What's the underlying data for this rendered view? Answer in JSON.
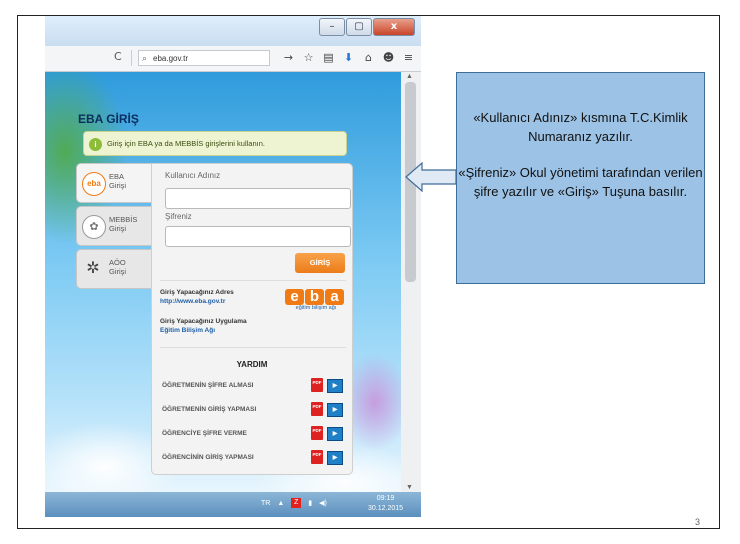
{
  "browser": {
    "window_buttons": {
      "minimize": "–",
      "maximize": "▢",
      "close": "x"
    },
    "reload_icon": "C",
    "url": "eba.gov.tr",
    "toolbar_icons": [
      "→",
      "☆",
      "▤",
      "⬇",
      "⌂",
      "☻",
      "≡"
    ]
  },
  "page": {
    "title": "EBA GİRİŞ",
    "info_text": "Giriş için EBA ya da MEBBİS girişlerini kullanın.",
    "tabs": [
      {
        "label_line1": "EBA",
        "label_line2": "Girişi",
        "icon": "eba-logo-icon",
        "color": "#f07a14"
      },
      {
        "label_line1": "MEBBİS",
        "label_line2": "Girişi",
        "icon": "meb-emblem-icon",
        "color": "#8a8a8a"
      },
      {
        "label_line1": "AÖO",
        "label_line2": "Girişi",
        "icon": "aoo-icon",
        "color": "#555555"
      }
    ],
    "form": {
      "username_label": "Kullanıcı Adınız",
      "username_value": "",
      "password_label": "Şifreniz",
      "password_value": "",
      "submit_label": "GİRİŞ"
    },
    "address_label": "Giriş Yapacağınız Adres",
    "address_value": "http://www.eba.gov.tr",
    "app_label": "Giriş Yapacağınız Uygulama",
    "app_value": "Eğitim Bilişim Ağı",
    "eba_logo_letters": [
      "e",
      "b",
      "a"
    ],
    "eba_logo_sub": "eğitim bilişim ağı",
    "help_title": "YARDIM",
    "help_items": [
      "ÖĞRETMENİN ŞİFRE ALMASI",
      "ÖĞRETMENİN GİRİŞ YAPMASI",
      "ÖĞRENCİYE ŞİFRE VERME",
      "ÖĞRENCİNİN GİRİŞ YAPMASI"
    ],
    "help_pdf_label": "PDF",
    "help_video_label": "▶"
  },
  "taskbar": {
    "lang": "TR",
    "time": "09:19",
    "date": "30.12.2015"
  },
  "callout": {
    "paragraph1": "«Kullanıcı Adınız» kısmına T.C.Kimlik Numaranız yazılır.",
    "paragraph2": "«Şifreniz» Okul yönetimi tarafından verilen şifre yazılır ve «Giriş» Tuşuna basılır."
  },
  "slide_number": "3",
  "colors": {
    "accent_orange": "#ec7c19",
    "callout_fill": "#9cc3e6",
    "callout_border": "#3f6d99"
  }
}
